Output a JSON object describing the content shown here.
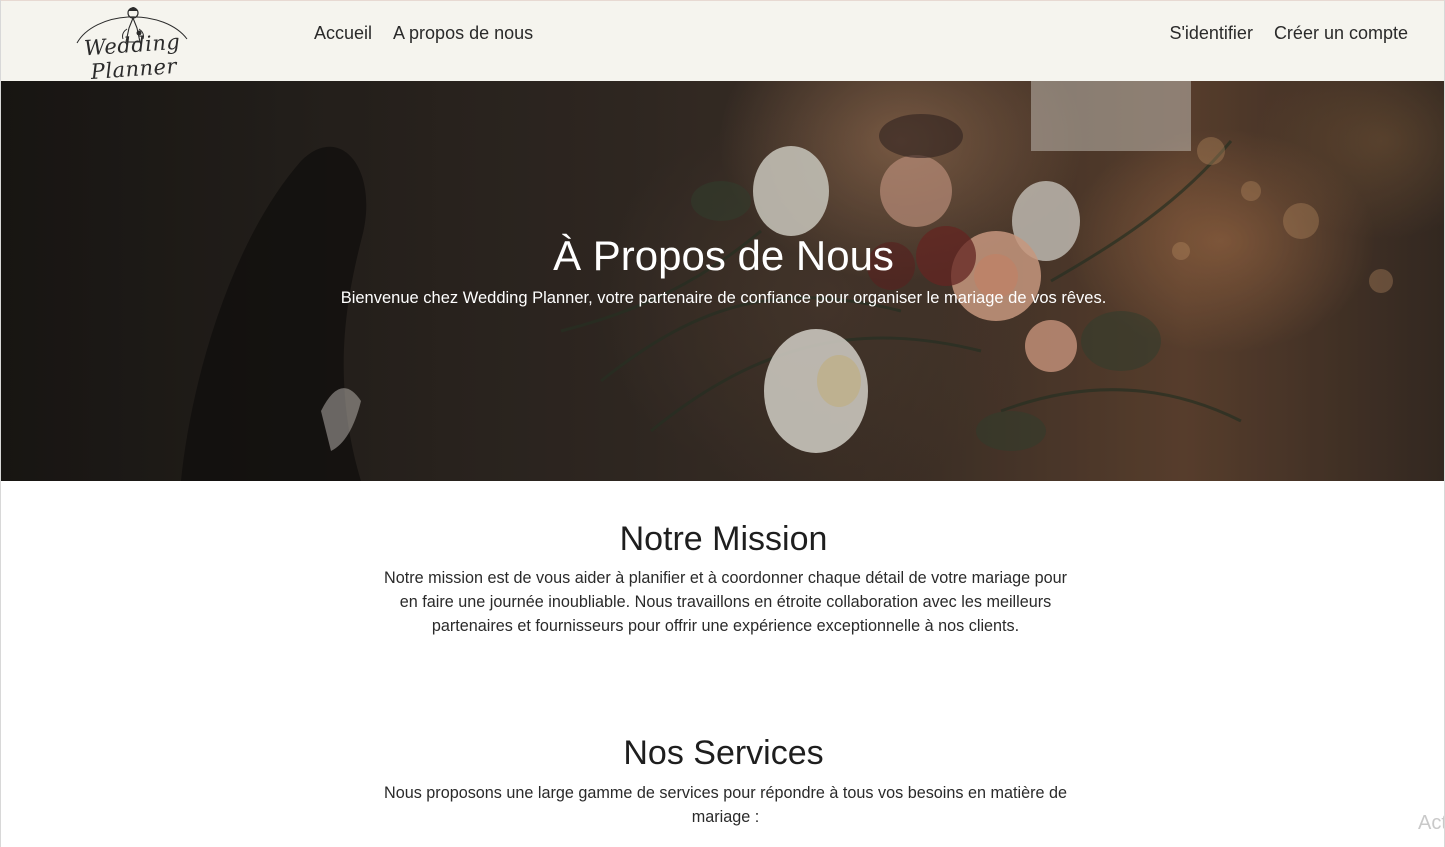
{
  "navbar": {
    "logo_text": "Wedding Planner",
    "links_left": [
      {
        "label": "Accueil"
      },
      {
        "label": "A propos de nous"
      }
    ],
    "links_right": [
      {
        "label": "S'identifier"
      },
      {
        "label": "Créer un compte"
      }
    ]
  },
  "hero": {
    "title": "À Propos de Nous",
    "subtitle": "Bienvenue chez Wedding Planner, votre partenaire de confiance pour organiser le mariage de vos rêves."
  },
  "mission": {
    "title": "Notre Mission",
    "text": "Notre mission est de vous aider à planifier et à coordonner chaque détail de votre mariage pour en faire une journée inoubliable. Nous travaillons en étroite collaboration avec les meilleurs partenaires et fournisseurs pour offrir une expérience exceptionnelle à nos clients."
  },
  "services": {
    "title": "Nos Services",
    "text": "Nous proposons une large gamme de services pour répondre à tous vos besoins en matière de mariage :"
  },
  "watermark": {
    "text": "Act"
  },
  "colors": {
    "navbar_bg": "#f5f4ee",
    "text_dark": "#222222",
    "hero_text": "#ffffff"
  }
}
